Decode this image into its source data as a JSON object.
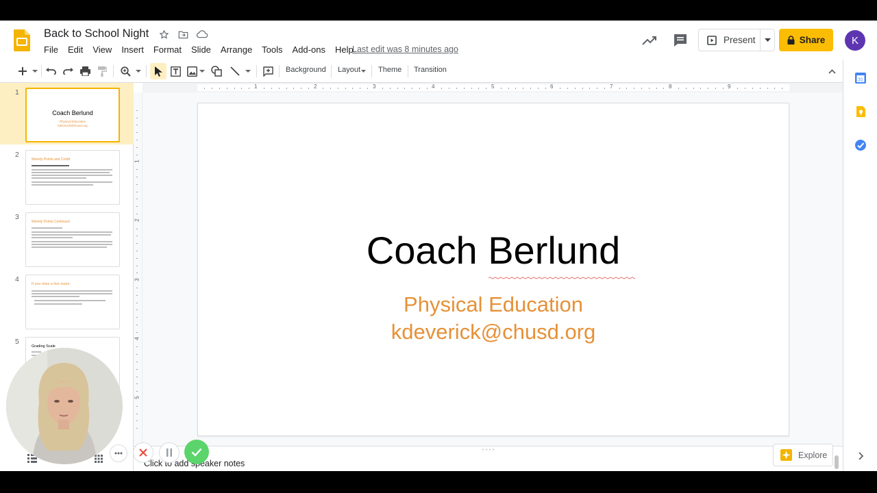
{
  "document": {
    "title": "Back to School Night",
    "last_edit": "Last edit was 8 minutes ago"
  },
  "menu": [
    "File",
    "Edit",
    "View",
    "Insert",
    "Format",
    "Slide",
    "Arrange",
    "Tools",
    "Add-ons",
    "Help"
  ],
  "header_actions": {
    "present_label": "Present",
    "share_label": "Share",
    "avatar_letter": "K"
  },
  "toolbar": {
    "background_label": "Background",
    "layout_label": "Layout",
    "theme_label": "Theme",
    "transition_label": "Transition"
  },
  "filmstrip": {
    "slides": [
      {
        "number": "1",
        "title": "Coach Berlund",
        "lines": [
          "Physical Education",
          "kdeverick@chusd.org"
        ]
      },
      {
        "number": "2",
        "title": "Weekly Points and Credit"
      },
      {
        "number": "3",
        "title": "Weekly Points Continued"
      },
      {
        "number": "4",
        "title": "If you miss a live zoom"
      },
      {
        "number": "5",
        "title": "Grading Scale"
      }
    ]
  },
  "rulers": {
    "horizontal": [
      "1",
      "2",
      "3",
      "4",
      "5",
      "6",
      "7",
      "8",
      "9"
    ],
    "vertical": [
      "1",
      "2",
      "3",
      "4",
      "5"
    ]
  },
  "slide": {
    "title": "Coach Berlund",
    "subtitle_line1": "Physical Education",
    "subtitle_line2": "kdeverick@chusd.org"
  },
  "notes": {
    "placeholder": "Click to add speaker notes"
  },
  "explore": {
    "label": "Explore"
  },
  "colors": {
    "accent_yellow": "#fbbc04",
    "subtitle_orange": "#e69138",
    "avatar_purple": "#5e35b1",
    "selected_slide_bg": "#feefc3"
  },
  "recorder": {
    "more_icon": "more-horizontal-icon",
    "cancel_icon": "close-icon",
    "pause_icon": "pause-icon",
    "done_icon": "check-icon"
  }
}
